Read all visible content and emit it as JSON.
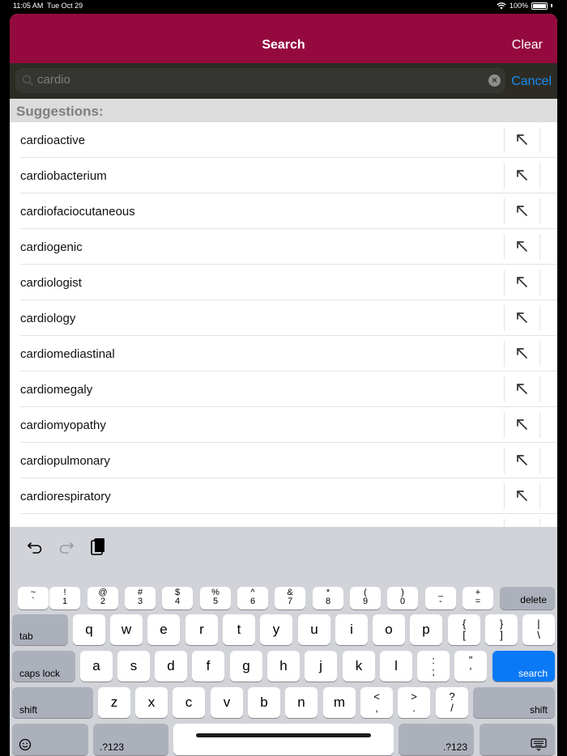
{
  "status_bar": {
    "time": "11:05 AM",
    "date": "Tue Oct 29",
    "battery": "100%"
  },
  "nav": {
    "title": "Search",
    "clear_label": "Clear"
  },
  "search": {
    "value": "cardio",
    "cancel_label": "Cancel"
  },
  "suggestions": {
    "header": "Suggestions:",
    "items": [
      "cardioactive",
      "cardiobacterium",
      "cardiofaciocutaneous",
      "cardiogenic",
      "cardiologist",
      "cardiology",
      "cardiomediastinal",
      "cardiomegaly",
      "cardiomyopathy",
      "cardiopulmonary",
      "cardiorespiratory"
    ]
  },
  "keyboard": {
    "toolbar_icons": [
      "undo-icon",
      "redo-icon",
      "paste-icon"
    ],
    "row1": [
      {
        "top": "~",
        "bot": "`"
      },
      {
        "top": "!",
        "bot": "1"
      },
      {
        "top": "@",
        "bot": "2"
      },
      {
        "top": "#",
        "bot": "3"
      },
      {
        "top": "$",
        "bot": "4"
      },
      {
        "top": "%",
        "bot": "5"
      },
      {
        "top": "^",
        "bot": "6"
      },
      {
        "top": "&",
        "bot": "7"
      },
      {
        "top": "*",
        "bot": "8"
      },
      {
        "top": "(",
        "bot": "9"
      },
      {
        "top": ")",
        "bot": "0"
      },
      {
        "top": "_",
        "bot": "-"
      },
      {
        "top": "+",
        "bot": "="
      }
    ],
    "delete_label": "delete",
    "tab_label": "tab",
    "row2_letters": [
      "q",
      "w",
      "e",
      "r",
      "t",
      "y",
      "u",
      "i",
      "o",
      "p"
    ],
    "row2_punct": [
      {
        "top": "{",
        "bot": "["
      },
      {
        "top": "}",
        "bot": "]"
      },
      {
        "top": "|",
        "bot": "\\"
      }
    ],
    "caps_label": "caps lock",
    "row3_letters": [
      "a",
      "s",
      "d",
      "f",
      "g",
      "h",
      "j",
      "k",
      "l"
    ],
    "row3_punct": [
      {
        "top": ":",
        "bot": ";"
      },
      {
        "top": "”",
        "bot": "’"
      }
    ],
    "search_label": "search",
    "shift_label": "shift",
    "row4_letters": [
      "z",
      "x",
      "c",
      "v",
      "b",
      "n",
      "m"
    ],
    "row4_punct": [
      {
        "top": "<",
        "bot": ","
      },
      {
        "top": ">",
        "bot": "."
      },
      {
        "top": "?",
        "bot": "/"
      }
    ],
    "numbers_label": ".?123",
    "emoji_icon": "emoji-icon",
    "dismiss_icon": "keyboard-dismiss-icon"
  }
}
